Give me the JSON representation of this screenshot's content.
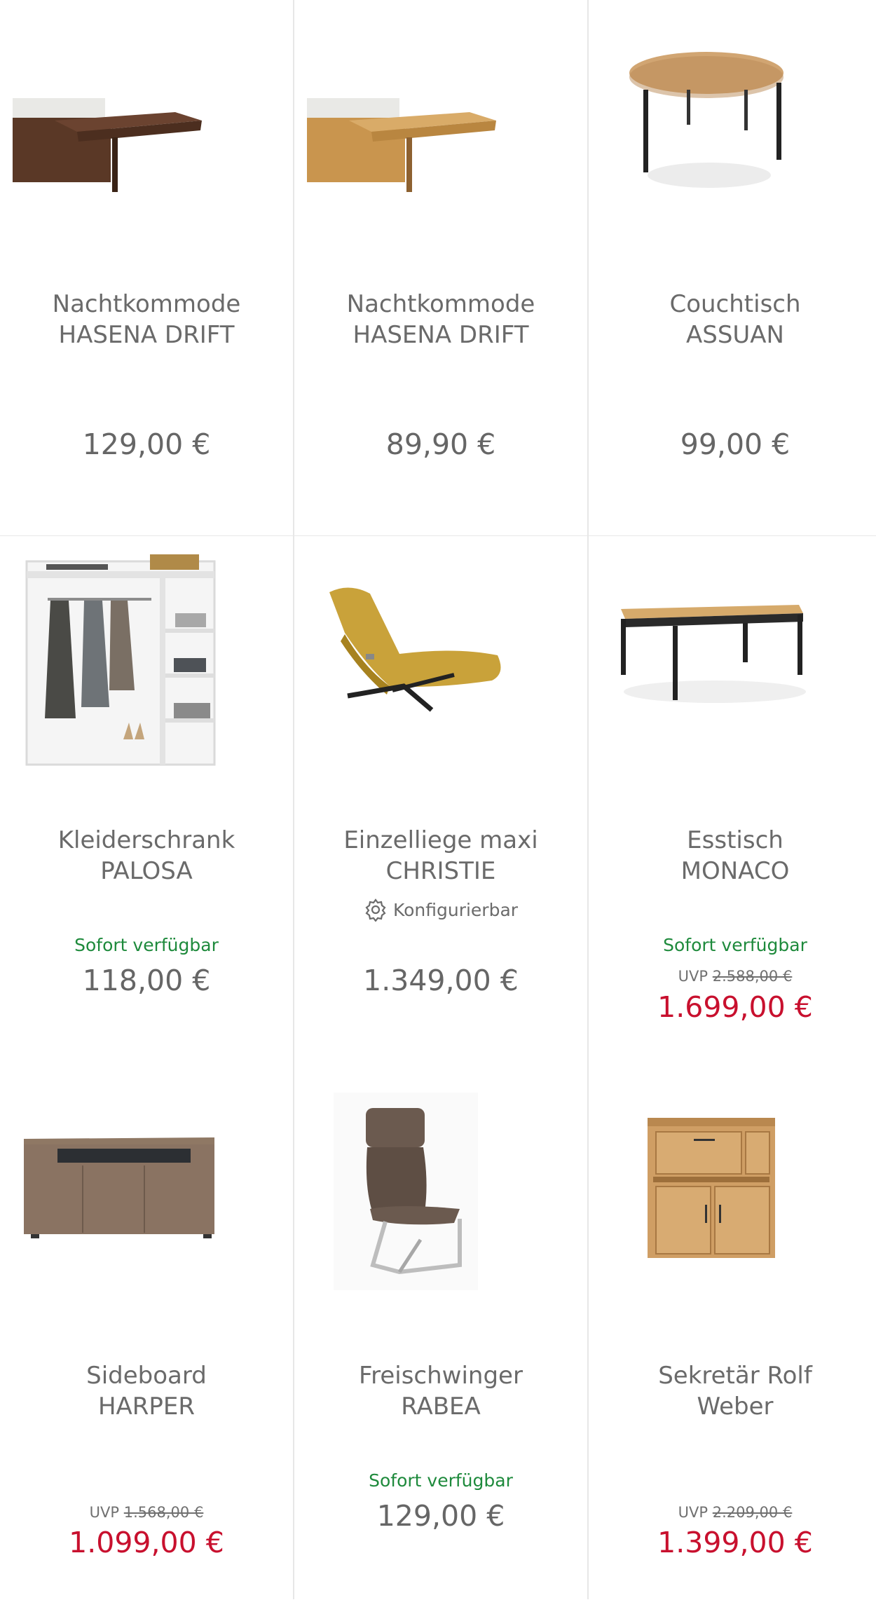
{
  "products": [
    {
      "title_line1": "Nachtkommode",
      "title_line2": "HASENA DRIFT",
      "price": "129,00 €",
      "icon": "walnut-nightstand-image"
    },
    {
      "title_line1": "Nachtkommode",
      "title_line2": "HASENA DRIFT",
      "price": "89,90 €",
      "icon": "oak-nightstand-image"
    },
    {
      "title_line1": "Couchtisch",
      "title_line2": "ASSUAN",
      "price": "99,00 €",
      "icon": "round-coffee-table-image"
    },
    {
      "title_line1": "Kleiderschrank",
      "title_line2": "PALOSA",
      "availability": "Sofort verfügbar",
      "price": "118,00 €",
      "icon": "open-wardrobe-image"
    },
    {
      "title_line1": "Einzelliege maxi",
      "title_line2": "CHRISTIE",
      "configurable": "Konfigurierbar",
      "price": "1.349,00 €",
      "icon": "lounge-chair-image"
    },
    {
      "title_line1": "Esstisch",
      "title_line2": "MONACO",
      "availability": "Sofort verfügbar",
      "uvp_label": "UVP",
      "uvp_price": "2.588,00 €",
      "price": "1.699,00 €",
      "icon": "dining-table-image"
    },
    {
      "title_line1": "Sideboard",
      "title_line2": "HARPER",
      "uvp_label": "UVP",
      "uvp_price": "1.568,00 €",
      "price": "1.099,00 €",
      "icon": "sideboard-image"
    },
    {
      "title_line1": "Freischwinger",
      "title_line2": "RABEA",
      "availability": "Sofort verfügbar",
      "price": "129,00 €",
      "icon": "cantilever-chair-image"
    },
    {
      "title_line1": "Sekretär Rolf",
      "title_line2": "Weber",
      "uvp_label": "UVP",
      "uvp_price": "2.209,00 €",
      "price": "1.399,00 €",
      "icon": "secretary-desk-image"
    }
  ],
  "colors": {
    "sale": "#c8102e",
    "available": "#1e8a3c",
    "text": "#666666",
    "divider": "#e7e7e7"
  }
}
